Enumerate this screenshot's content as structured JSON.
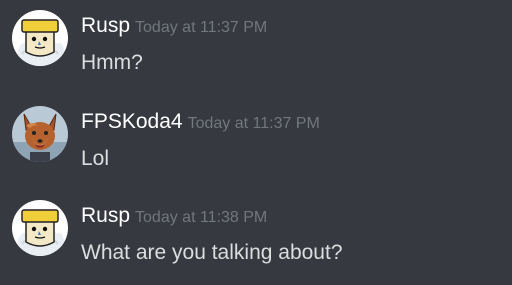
{
  "messages": [
    {
      "username": "Rusp",
      "timestamp": "Today at 11:37 PM",
      "text": "Hmm?",
      "avatar_icon": "yellow-hat-face-icon"
    },
    {
      "username": "FPSKoda4",
      "timestamp": "Today at 11:37 PM",
      "text": "Lol",
      "avatar_icon": "fox-face-icon"
    },
    {
      "username": "Rusp",
      "timestamp": "Today at 11:38 PM",
      "text": "What are you talking about?",
      "avatar_icon": "yellow-hat-face-icon"
    }
  ],
  "colors": {
    "background": "#36393f",
    "username": "#ffffff",
    "timestamp": "#72767d",
    "message_text": "#dcddde"
  }
}
